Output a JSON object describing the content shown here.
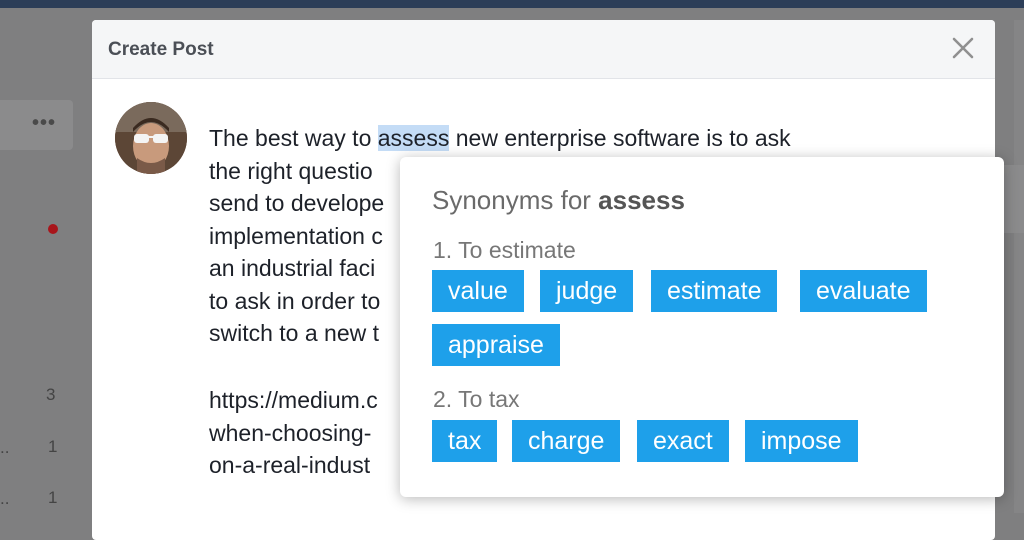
{
  "background": {
    "menu_dots": "•••",
    "counts": [
      "3",
      "1",
      "1"
    ],
    "ellipses": [
      "..",
      ".."
    ]
  },
  "modal": {
    "title": "Create Post",
    "close_icon": "close-icon"
  },
  "post": {
    "lines": [
      {
        "before": "The best way to ",
        "highlight": "assess",
        "after": " new enterprise software is to ask"
      },
      {
        "text": "the right questio"
      },
      {
        "text": "send to develope"
      },
      {
        "text": "implementation c"
      },
      {
        "text": "an industrial faci"
      },
      {
        "text": "to ask in order to"
      },
      {
        "text": "switch to a new t"
      }
    ],
    "link_lines": [
      "https://medium.c",
      "when-choosing-",
      "on-a-real-indust"
    ]
  },
  "synonyms": {
    "title_prefix": "Synonyms for ",
    "word": "assess",
    "senses": [
      {
        "label": "1. To estimate",
        "words": [
          "value",
          "judge",
          "estimate",
          "evaluate",
          "appraise"
        ]
      },
      {
        "label": "2. To tax",
        "words": [
          "tax",
          "charge",
          "exact",
          "impose"
        ]
      }
    ],
    "chip_color": "#1ea0ea"
  }
}
